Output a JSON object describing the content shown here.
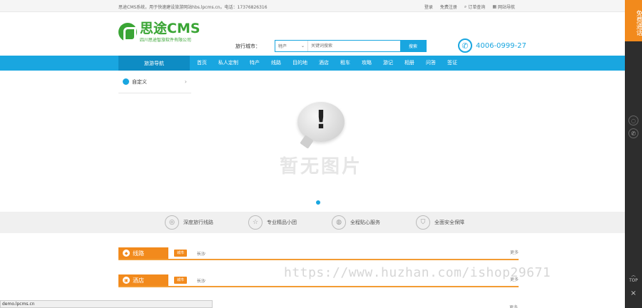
{
  "topbar": {
    "welcome": "思途CMS系统，用于快速建设旅游网站hbs.lpcms.cn。电话：17376826316",
    "links": [
      "登录",
      "免费注册",
      "订单查询",
      "网站导航"
    ]
  },
  "header": {
    "logo_main": "思途CMS",
    "logo_sub": "四川思途智旅软件有限公司",
    "city_label": "旅行城市：",
    "search_select": "特产",
    "search_placeholder": "关键词搜索",
    "search_button": "搜索",
    "phone": "4006-0999-27"
  },
  "nav": {
    "category": "旅游导航",
    "items": [
      "首页",
      "私人定制",
      "特产",
      "线路",
      "目的地",
      "酒店",
      "租车",
      "攻略",
      "游记",
      "相册",
      "问答",
      "签证"
    ]
  },
  "banner": {
    "side_category": "自定义",
    "placeholder_text": "暂无图片"
  },
  "features": [
    "深度旅行线路",
    "专业精品小团",
    "全程贴心服务",
    "全面安全保障"
  ],
  "sections": [
    {
      "title": "线路",
      "pill": "城市",
      "city": "长沙",
      "more": "更多"
    },
    {
      "title": "酒店",
      "pill": "城市",
      "city": "长沙",
      "more": "更多"
    }
  ],
  "more_third": "更多",
  "floatbar": {
    "call": "免费通话",
    "top": "TOP",
    "close": "×"
  },
  "watermark": "https://www.huzhan.com/ishop29671",
  "status_url": "demo.lpcms.cn",
  "colors": {
    "primary": "#19a6e0",
    "accent": "#f28a1c",
    "brand_green": "#3aa535"
  }
}
